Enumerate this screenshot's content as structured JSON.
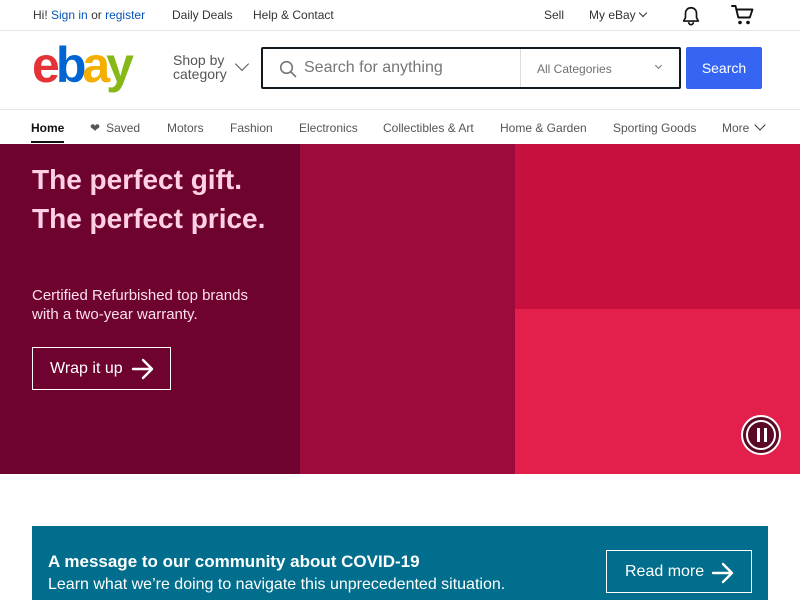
{
  "topbar": {
    "greeting_prefix": "Hi!",
    "sign_in": "Sign in",
    "or": "or",
    "register": "register",
    "daily_deals": "Daily Deals",
    "help_contact": "Help & Contact",
    "sell": "Sell",
    "my_ebay": "My eBay"
  },
  "header": {
    "shop_by_line1": "Shop by",
    "shop_by_line2": "category",
    "search_placeholder": "Search for anything",
    "category_selected": "All Categories",
    "search_button": "Search"
  },
  "nav": {
    "items": [
      "Home",
      "Saved",
      "Motors",
      "Fashion",
      "Electronics",
      "Collectibles & Art",
      "Home & Garden",
      "Sporting Goods",
      "More"
    ],
    "active": "Home"
  },
  "hero": {
    "title": "The perfect gift. The perfect price.",
    "subtitle": "Certified Refurbished top brands with a two-year warranty.",
    "cta": "Wrap it up"
  },
  "covid": {
    "title": "A message to our community about COVID-19",
    "subtitle": "Learn what we’re doing to navigate this unprecedented situation.",
    "cta": "Read more"
  },
  "colors": {
    "brand_blue": "#3665f3",
    "hero_dark": "#6f0330",
    "hero_mid": "#9c0b3b",
    "hero_red": "#c8103f",
    "hero_pink": "#e2204b",
    "covid_teal": "#006e8c"
  },
  "icons": [
    "bell-icon",
    "cart-icon",
    "search-icon",
    "heart-icon",
    "arrow-right-icon",
    "pause-icon",
    "chevron-down-icon"
  ]
}
